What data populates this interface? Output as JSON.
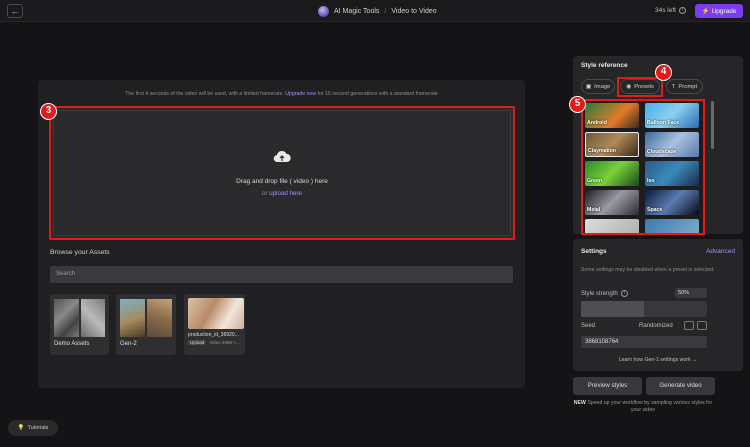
{
  "header": {
    "back_icon": "arrow-left-icon",
    "app_name": "AI Magic Tools",
    "separator": "/",
    "page_title": "Video to Video",
    "credits": "34s left",
    "info_icon": "info-icon",
    "upgrade_label": "Upgrade",
    "upgrade_icon": "lightning-icon",
    "accent": "#7b3cf0"
  },
  "main": {
    "notice_prefix": "The first 4 seconds of the video will be used, with a limited framerate.",
    "notice_link": "Upgrade now",
    "notice_suffix": "for 15 second generations with a standard framerate",
    "drop_title": "Drag and drop file ( video ) here",
    "drop_or": "or",
    "drop_link": "upload here",
    "upload_icon": "upload-cloud-icon",
    "browse_title": "Browse your Assets",
    "search_placeholder": "Search",
    "assets": [
      {
        "label": "Demo Assets"
      },
      {
        "label": "Gen-2"
      },
      {
        "name": "production_id_36920...",
        "tag": "Upload",
        "meta": "Video 4096 ×..."
      }
    ]
  },
  "markers": {
    "m3": "3",
    "m4": "4",
    "m5": "5",
    "color": "#e51919"
  },
  "style_reference": {
    "title": "Style reference",
    "tabs": [
      {
        "label": "Image",
        "icon": "image-icon"
      },
      {
        "label": "Presets",
        "icon": "palette-icon"
      },
      {
        "label": "Prompt",
        "icon": "text-icon"
      }
    ],
    "presets": [
      "Android",
      "Balloon Face",
      "Claymation",
      "Cloudscape",
      "Green",
      "Iso",
      "Metal",
      "Space"
    ]
  },
  "settings": {
    "title": "Settings",
    "advanced": "Advanced",
    "note": "Some settings may be disabled when a preset is selected.",
    "style_strength_label": "Style strength",
    "style_strength_value": "50%",
    "style_strength_fraction": 0.5,
    "seed_label": "Seed",
    "randomized_label": "Randomized",
    "seed_value": "3868108764",
    "learn_link": "Learn how Gen-1 settings work →"
  },
  "actions": {
    "preview": "Preview styles",
    "generate": "Generate video",
    "new_label": "NEW",
    "note": "Speed up your workflow by sampling various styles for your video"
  },
  "tutorials": {
    "label": "Tutorials",
    "icon": "lightbulb-icon"
  }
}
